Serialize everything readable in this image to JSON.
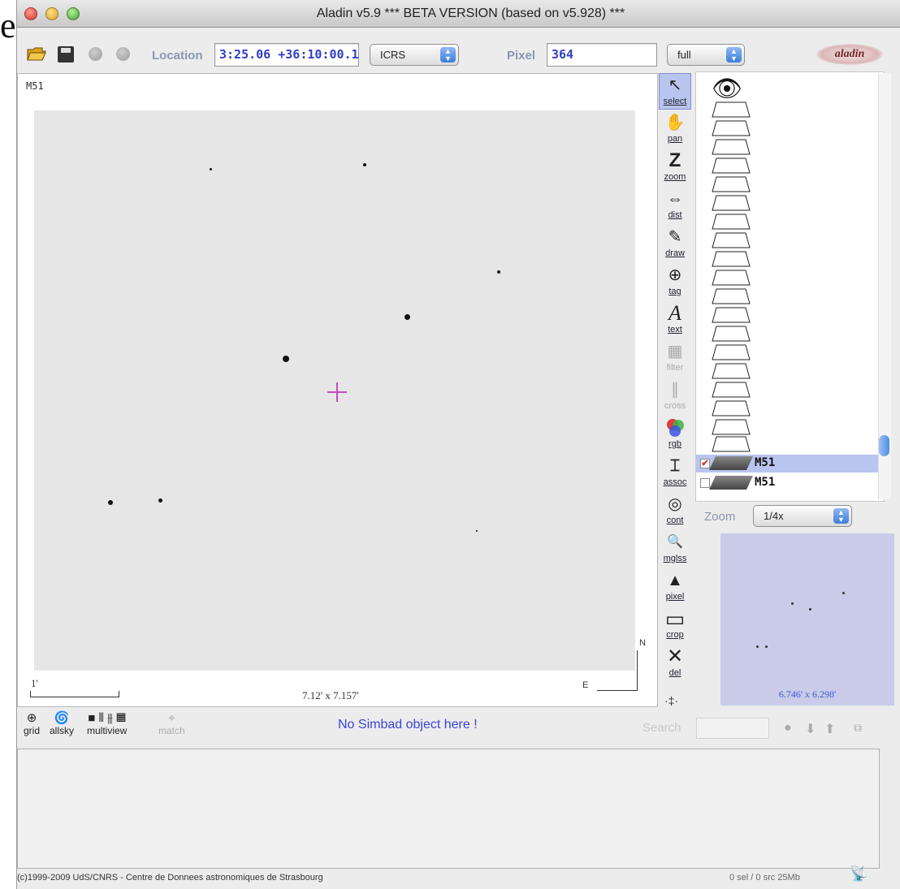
{
  "window": {
    "title": "Aladin v5.9    *** BETA VERSION (based on v5.928) ***"
  },
  "toolbar": {
    "location_label": "Location",
    "location_value": "3:25.06 +36:10:00.1",
    "frame_value": "ICRS",
    "pixel_label": "Pixel",
    "pixel_value": "364",
    "pixel_mode": "full",
    "logo_text": "aladin"
  },
  "view": {
    "plane_label": "M51",
    "scale_label": "1'",
    "field_size": "7.12' x 7.157'",
    "north_label": "N",
    "east_label": "E"
  },
  "tools": [
    {
      "name": "select",
      "glyph": "↖"
    },
    {
      "name": "pan",
      "glyph": "✋"
    },
    {
      "name": "zoom",
      "glyph": "Z"
    },
    {
      "name": "dist",
      "glyph": "⇔"
    },
    {
      "name": "draw",
      "glyph": "✎"
    },
    {
      "name": "tag",
      "glyph": "⊕"
    },
    {
      "name": "text",
      "glyph": "A"
    },
    {
      "name": "filter",
      "glyph": "▦"
    },
    {
      "name": "cross",
      "glyph": "∥"
    },
    {
      "name": "rgb",
      "glyph": "●"
    },
    {
      "name": "assoc",
      "glyph": "⌶"
    },
    {
      "name": "cont",
      "glyph": "◎"
    },
    {
      "name": "mglss",
      "glyph": "🔍"
    },
    {
      "name": "pixel",
      "glyph": "▲"
    },
    {
      "name": "crop",
      "glyph": "▭"
    },
    {
      "name": "del",
      "glyph": "✕"
    }
  ],
  "layers": [
    {
      "name": "M51",
      "checked": true,
      "selected": true
    },
    {
      "name": "M51",
      "checked": false,
      "selected": false
    }
  ],
  "zoom": {
    "label": "Zoom",
    "value": "1/4x",
    "field_size": "6.746' x 6.298'"
  },
  "bottom": {
    "grid_label": "grid",
    "allsky_label": "allsky",
    "multiview_label": "multiview",
    "match_label": "match",
    "simbad_message": "No Simbad object here !",
    "search_label": "Search"
  },
  "footer": {
    "copyright": "(c)1999-2009 UdS/CNRS - Centre de Donnees astronomiques de Strasbourg",
    "status": "0 sel / 0 src   25Mb"
  },
  "colors": {
    "accent_blue": "#3c43d6",
    "selection": "#b9c5ee",
    "cursor": "#c24ac2"
  }
}
